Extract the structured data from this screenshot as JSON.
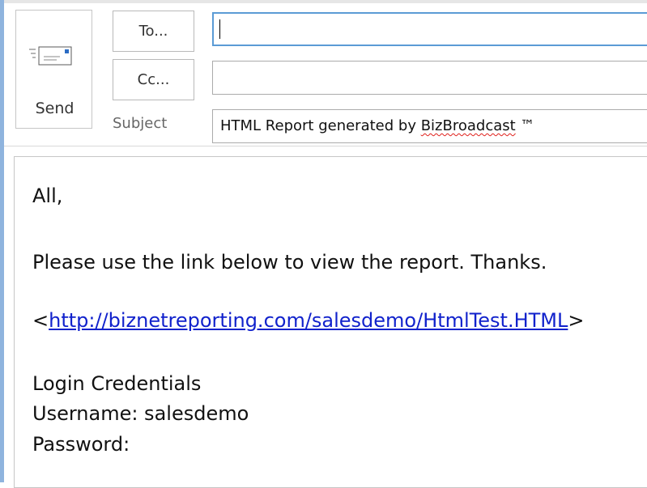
{
  "header": {
    "send_label": "Send",
    "to_label": "To...",
    "cc_label": "Cc...",
    "subject_label": "Subject",
    "to_value": "",
    "cc_value": "",
    "subject_prefix": "HTML Report generated by ",
    "subject_brand": "BizBroadcast",
    "subject_suffix": " ™"
  },
  "message": {
    "greeting": "All,",
    "line1": "Please use the link below to view the report. Thanks.",
    "link_open": "<",
    "link_url": "http://biznetreporting.com/salesdemo/HtmlTest.HTML",
    "link_close": ">",
    "credentials_heading": "Login Credentials",
    "username_line": "Username: salesdemo",
    "password_line": "Password:"
  },
  "icons": {
    "send": "send-envelope-icon"
  }
}
